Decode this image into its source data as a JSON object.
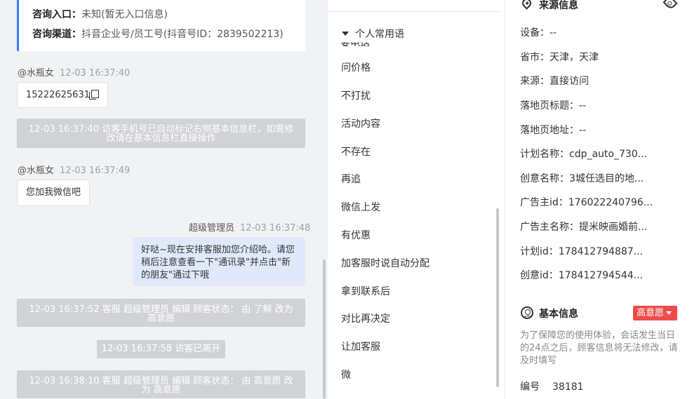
{
  "inquiry_card": {
    "entry_label": "咨询入口：",
    "entry_value": "未知(暂无入口信息)",
    "channel_label": "咨询渠道：",
    "channel_value": "抖音企业号/员工号(抖音号ID：2839502213)"
  },
  "messages": [
    {
      "sender": "@水瓶女",
      "time": "12-03 16:37:40",
      "text": "15222625631"
    },
    {
      "system": "12-03 16:37:40 访客手机号已自动标记右侧基本信息栏，如需修改请在基本信息栏直接操作"
    },
    {
      "sender": "@水瓶女",
      "time": "12-03 16:37:49",
      "text": "您加我微信吧"
    },
    {
      "sender": "超级管理员",
      "time": "12-03 16:37:48",
      "text": "好哒~现在安排客服加您介绍哈。请您稍后注意查看一下\"通讯录\"并点击\"新的朋友\"通过下哦"
    },
    {
      "system": "12-03 16:37:52 客服 超级管理员 编辑 顾客状态： 由 了解 改为 高意愿"
    },
    {
      "system": "12-03 16:37:58 访客已离开"
    },
    {
      "system": "12-03 16:38:10 客服 超级管理员 编辑 顾客状态： 由 高意愿 改为 高意愿"
    }
  ],
  "phrases": {
    "header": "个人常用语",
    "clipped_item": "要电话",
    "items": [
      "问价格",
      "不打扰",
      "活动内容",
      "不存在",
      "再追",
      "微信上发",
      "有优惠",
      "加客服时说自动分配",
      "拿到联系后",
      "对比再决定",
      "让加客服",
      "微"
    ]
  },
  "source_info": {
    "title": "来源信息",
    "fields": [
      "设备：--",
      "省市：天津，天津",
      "来源：直接访问",
      "落地页标题：--",
      "落地页地址：--",
      "计划名称：cdp_auto_730...",
      "创意名称：3城任选目的地...",
      "广告主id：176022240796...",
      "广告主名称：提米映画婚前...",
      "计划id：178412794887...",
      "创意id：178412794544..."
    ]
  },
  "basic_info": {
    "title": "基本信息",
    "status_badge": "高意愿",
    "notice": "为了保障您的使用体验，会话发生当日的24点之后，顾客信息将无法修改，请及时填写",
    "serial_label": "编号",
    "serial_value": "38181"
  },
  "colors": {
    "accent": "#3d7bf0",
    "badge": "#f04b4b",
    "agent_bubble": "#dfe9fb",
    "system_bar": "#d0d2d6"
  },
  "icons": [
    "copy-icon",
    "caret-down-icon",
    "location-pin-icon",
    "eye-icon",
    "user-circle-icon",
    "dropdown-caret-icon"
  ]
}
